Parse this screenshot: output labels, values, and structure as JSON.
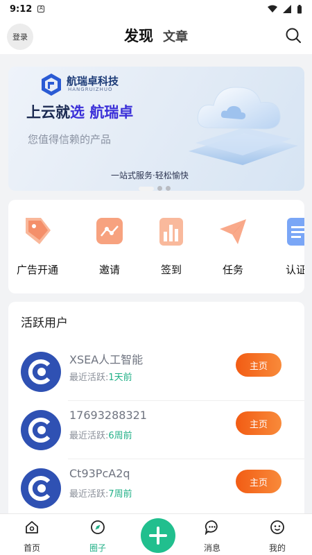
{
  "status_bar": {
    "time": "9:12"
  },
  "header": {
    "login_label": "登录",
    "tabs": [
      {
        "label": "发现",
        "active": true
      },
      {
        "label": "文章",
        "active": false
      }
    ],
    "search_icon": "search-icon"
  },
  "banner": {
    "brand_name": "航瑞卓科技",
    "brand_sub": "HANGRUIZHUO",
    "headline_prefix": "上云就",
    "headline_mid": "选 ",
    "headline_brand": "航瑞卓",
    "subline": "您值得信赖的产品",
    "tagline": "一站式服务·轻松愉快",
    "slides": 3,
    "active_slide": 1
  },
  "quick_actions": [
    {
      "label": "广告开通",
      "icon": "tag-icon"
    },
    {
      "label": "邀请",
      "icon": "share-icon"
    },
    {
      "label": "签到",
      "icon": "bar-chart-icon"
    },
    {
      "label": "任务",
      "icon": "paper-plane-icon"
    },
    {
      "label": "认证",
      "icon": "id-card-icon"
    }
  ],
  "active_users": {
    "title": "活跃用户",
    "active_prefix": "最近活跃:",
    "button_label": "主页",
    "users": [
      {
        "name": "XSEA人工智能",
        "last_active": "1天前"
      },
      {
        "name": "17693288321",
        "last_active": "6周前"
      },
      {
        "name": "Ct93PcA2q",
        "last_active": "7周前"
      }
    ]
  },
  "tab_bar": {
    "items": [
      {
        "label": "首页",
        "icon": "home-icon",
        "active": false
      },
      {
        "label": "圈子",
        "icon": "compass-icon",
        "active": true
      },
      {
        "label": "消息",
        "icon": "message-icon",
        "active": false
      },
      {
        "label": "我的",
        "icon": "profile-icon",
        "active": false
      }
    ],
    "center_icon": "plus-icon"
  },
  "colors": {
    "accent_green": "#21b087",
    "button_orange": "#f25c14",
    "avatar_blue": "#2f51b3",
    "banner_highlight": "#3a2fd8"
  }
}
